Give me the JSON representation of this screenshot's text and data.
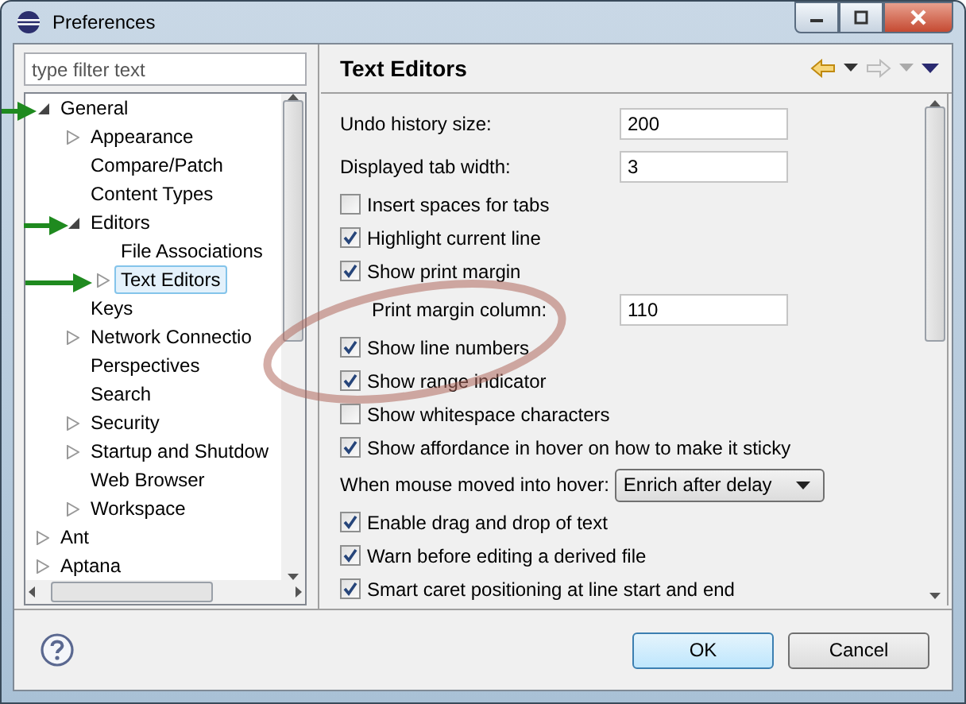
{
  "window": {
    "title": "Preferences"
  },
  "filter": {
    "placeholder": "type filter text"
  },
  "tree": [
    {
      "label": "General",
      "kind": "branch",
      "expanded": true,
      "selected": false,
      "children": [
        {
          "label": "Appearance",
          "kind": "branch",
          "expanded": false,
          "selected": false
        },
        {
          "label": "Compare/Patch",
          "kind": "leaf",
          "selected": false
        },
        {
          "label": "Content Types",
          "kind": "leaf",
          "selected": false
        },
        {
          "label": "Editors",
          "kind": "branch",
          "expanded": true,
          "selected": false,
          "children": [
            {
              "label": "File Associations",
              "kind": "leaf",
              "selected": false
            },
            {
              "label": "Text Editors",
              "kind": "branch",
              "expanded": false,
              "selected": true
            }
          ]
        },
        {
          "label": "Keys",
          "kind": "leaf",
          "selected": false
        },
        {
          "label": "Network Connectio",
          "kind": "branch",
          "expanded": false,
          "selected": false
        },
        {
          "label": "Perspectives",
          "kind": "leaf",
          "selected": false
        },
        {
          "label": "Search",
          "kind": "leaf",
          "selected": false
        },
        {
          "label": "Security",
          "kind": "branch",
          "expanded": false,
          "selected": false
        },
        {
          "label": "Startup and Shutdow",
          "kind": "branch",
          "expanded": false,
          "selected": false
        },
        {
          "label": "Web Browser",
          "kind": "leaf",
          "selected": false
        },
        {
          "label": "Workspace",
          "kind": "branch",
          "expanded": false,
          "selected": false
        }
      ]
    },
    {
      "label": "Ant",
      "kind": "branch",
      "expanded": false,
      "selected": false
    },
    {
      "label": "Aptana",
      "kind": "branch",
      "expanded": false,
      "selected": false
    }
  ],
  "page": {
    "title": "Text Editors",
    "settings": [
      {
        "kind": "field",
        "label": "Undo history size:",
        "value": "200"
      },
      {
        "kind": "field",
        "label": "Displayed tab width:",
        "value": "3"
      },
      {
        "kind": "checkbox",
        "label": "Insert spaces for tabs",
        "checked": false
      },
      {
        "kind": "checkbox",
        "label": "Highlight current line",
        "checked": true
      },
      {
        "kind": "checkbox",
        "label": "Show print margin",
        "checked": true
      },
      {
        "kind": "subfield",
        "label": "Print margin column:",
        "value": "110"
      },
      {
        "kind": "checkbox",
        "label": "Show line numbers",
        "checked": true
      },
      {
        "kind": "checkbox",
        "label": "Show range indicator",
        "checked": true
      },
      {
        "kind": "checkbox",
        "label": "Show whitespace characters",
        "checked": false
      },
      {
        "kind": "checkbox",
        "label": "Show affordance in hover on how to make it sticky",
        "checked": true
      },
      {
        "kind": "dropdown",
        "label": "When mouse moved into hover:",
        "value": "Enrich after delay"
      },
      {
        "kind": "checkbox",
        "label": "Enable drag and drop of text",
        "checked": true
      },
      {
        "kind": "checkbox",
        "label": "Warn before editing a derived file",
        "checked": true
      },
      {
        "kind": "checkbox",
        "label": "Smart caret positioning at line start and end",
        "checked": true
      }
    ]
  },
  "buttons": [
    {
      "label": "OK",
      "default": true
    },
    {
      "label": "Cancel",
      "default": false
    }
  ]
}
